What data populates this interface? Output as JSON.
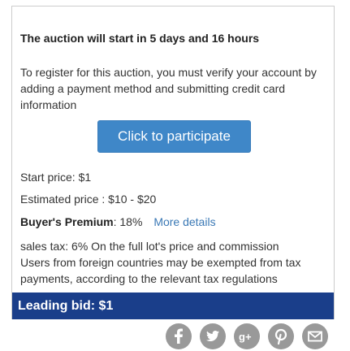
{
  "auction": {
    "start_notice": "The auction will start in 5 days and 16 hours",
    "register_text": "To register for this auction, you must verify your account by adding a payment method and submitting credit card information",
    "participate_label": "Click to participate",
    "start_price_label": "Start price:",
    "start_price_value": "$1",
    "estimated_label": "Estimated price :",
    "estimated_value": "$10 - $20",
    "premium_label": "Buyer's Premium",
    "premium_value": ": 18%",
    "more_details": "More details",
    "tax_line1": "sales tax: 6% On the full lot's price and commission",
    "tax_line2": "Users from foreign countries may be exempted from tax payments, according to the relevant tax regulations",
    "leading_bid": "Leading bid: $1"
  },
  "colors": {
    "button_blue": "#3f87c8",
    "bar_navy": "#1a3e8a",
    "link_blue": "#3a78b5",
    "social_gray": "#999999"
  },
  "social": [
    "facebook-icon",
    "twitter-icon",
    "google-plus-icon",
    "pinterest-icon",
    "email-icon"
  ]
}
